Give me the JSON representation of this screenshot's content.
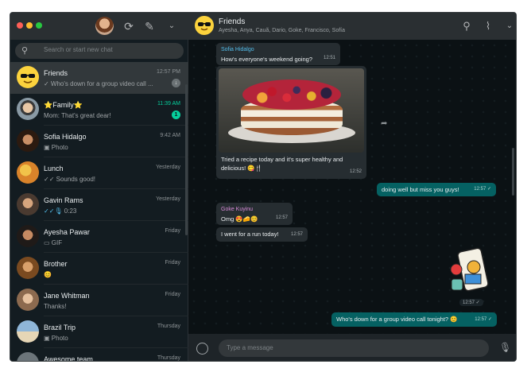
{
  "window": {
    "controls": [
      "close",
      "minimize",
      "zoom"
    ],
    "control_colors": [
      "#ff5f57",
      "#febc2e",
      "#28c840"
    ]
  },
  "sidebar": {
    "search_placeholder": "Search or start new chat",
    "chats": [
      {
        "name": "Friends",
        "preview": "✓ Who's down for a group video call ...",
        "time": "12:57 PM",
        "icon": "sunglasses-emoji",
        "pinned": true
      },
      {
        "name": "⭐Family⭐",
        "preview": "Mom: That's great dear!",
        "time": "11:39 AM",
        "badge": "1"
      },
      {
        "name": "Sofia Hidalgo",
        "preview": "Photo",
        "time": "9:42 AM"
      },
      {
        "name": "Lunch",
        "preview": "✓✓ Sounds good!",
        "time": "Yesterday"
      },
      {
        "name": "Gavin Rams",
        "preview": "0:23",
        "time": "Yesterday"
      },
      {
        "name": "Ayesha Pawar",
        "preview": "GIF",
        "time": "Friday"
      },
      {
        "name": "Brother",
        "preview": "😊",
        "time": "Friday"
      },
      {
        "name": "Jane Whitman",
        "preview": "Thanks!",
        "time": "Friday"
      },
      {
        "name": "Brazil Trip",
        "preview": "Photo",
        "time": "Thursday"
      },
      {
        "name": "Awesome team",
        "preview": "",
        "time": "Thursday"
      }
    ]
  },
  "conversation": {
    "title": "Friends",
    "members": "Ayesha, Anya, Cauã, Dario, Goke, Francisco, Sofía",
    "input_placeholder": "Type a message",
    "messages": {
      "m1": {
        "sender": "Sofia Hidalgo",
        "text": "How's everyone's weekend going?",
        "time": "12:51"
      },
      "m2": {
        "text": "Tried a recipe today and it's super healthy and delicious! 😋🍴",
        "time": "12:52"
      },
      "m3": {
        "text": "doing well but miss you guys!",
        "time": "12:57 ✓"
      },
      "m4": {
        "sender": "Goke Kuyinu",
        "text": "Omg 😍🧀😊",
        "time": "12:57"
      },
      "m5": {
        "text": "I went for a run today!",
        "time": "12:57"
      },
      "m6": {
        "time": "12:57 ✓"
      },
      "m7": {
        "text": "Who's down for a group video call tonight? 😊",
        "time": "12:57 ✓"
      }
    },
    "colors": {
      "sofia": "#53bdeb",
      "goke": "#d88bd8",
      "outgoing": "#056162",
      "incoming": "#262d31"
    }
  }
}
